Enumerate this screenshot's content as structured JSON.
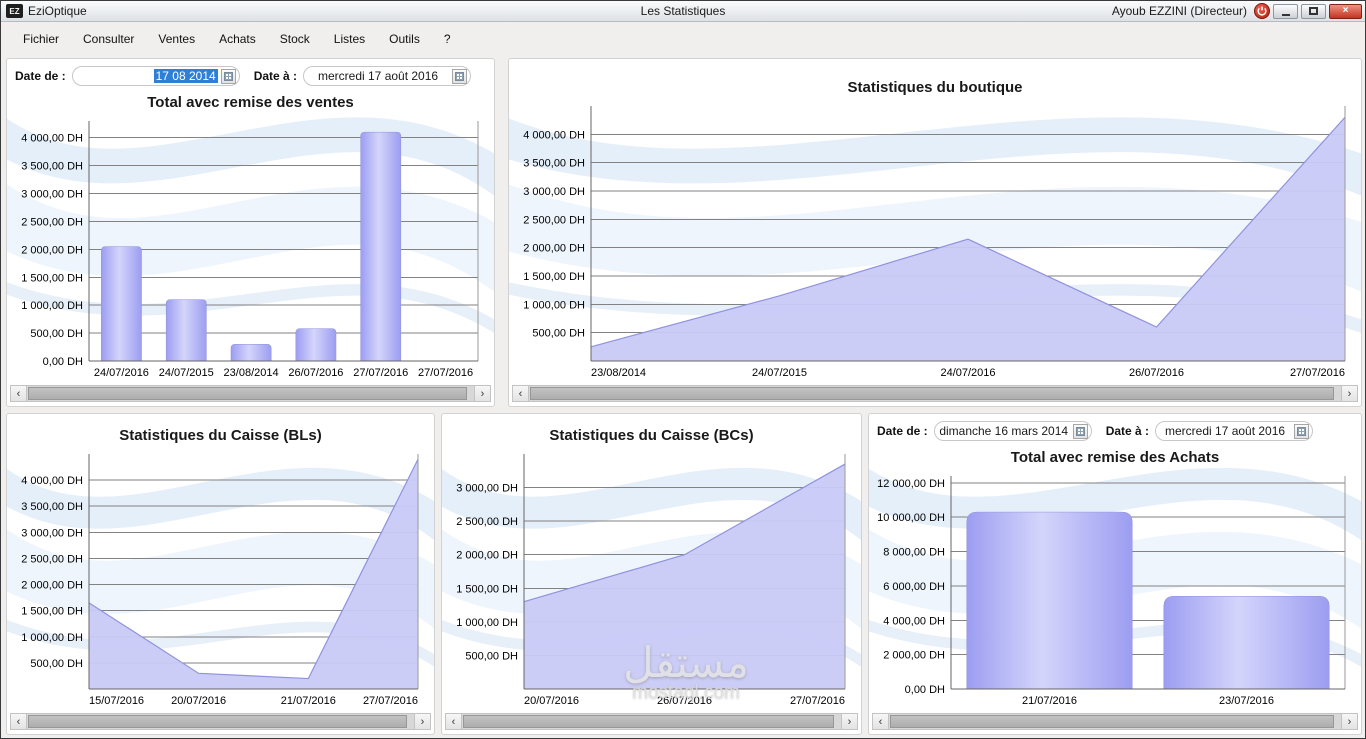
{
  "window": {
    "logo_text": "EZ",
    "app_name": "EziOptique",
    "title": "Les Statistiques",
    "user": "Ayoub EZZINI (Directeur)"
  },
  "icons": {
    "close": "×",
    "scroll_left": "‹",
    "scroll_right": "›"
  },
  "menu": {
    "items": [
      "Fichier",
      "Consulter",
      "Ventes",
      "Achats",
      "Stock",
      "Listes",
      "Outils",
      "?"
    ]
  },
  "filters": {
    "ventes": {
      "date_de_label": "Date de :",
      "date_de_value": "17 08 2014",
      "date_a_label": "Date à :",
      "date_a_value": "mercredi 17 août 2016"
    },
    "achats": {
      "date_de_label": "Date de :",
      "date_de_value": "dimanche 16 mars 2014",
      "date_a_label": "Date à :",
      "date_a_value": "mercredi 17 août 2016"
    }
  },
  "watermark": {
    "arabic": "مستقل",
    "latin": "mostaql.com"
  },
  "chart_data": [
    {
      "id": "ventes",
      "type": "bar",
      "title": "Total avec remise des ventes",
      "categories": [
        "24/07/2016",
        "24/07/2015",
        "23/08/2014",
        "26/07/2016",
        "27/07/2016",
        "27/07/2016"
      ],
      "values": [
        2050,
        1100,
        300,
        580,
        4100,
        0
      ],
      "ytick_values": [
        0,
        500,
        1000,
        1500,
        2000,
        2500,
        3000,
        3500,
        4000
      ],
      "ytick_labels": [
        "0,00 DH",
        "500,00 DH",
        "1 000,00 DH",
        "1 500,00 DH",
        "2 000,00 DH",
        "2 500,00 DH",
        "3 000,00 DH",
        "3 500,00 DH",
        "4 000,00 DH"
      ],
      "ymax": 4300,
      "xlabel": "",
      "ylabel": "",
      "grid": true,
      "legend": "none",
      "bar_width_ratio": 0.62,
      "bar_color": "#b4b5f3"
    },
    {
      "id": "boutique",
      "type": "area",
      "title": "Statistiques du boutique",
      "categories": [
        "23/08/2014",
        "24/07/2015",
        "24/07/2016",
        "26/07/2016",
        "27/07/2016"
      ],
      "values": [
        250,
        1150,
        2150,
        600,
        4300
      ],
      "ytick_values": [
        500,
        1000,
        1500,
        2000,
        2500,
        3000,
        3500,
        4000
      ],
      "ytick_labels": [
        "500,00 DH",
        "1 000,00 DH",
        "1 500,00 DH",
        "2 000,00 DH",
        "2 500,00 DH",
        "3 000,00 DH",
        "3 500,00 DH",
        "4 000,00 DH"
      ],
      "ymax": 4500,
      "xlabel": "",
      "ylabel": "",
      "grid": true,
      "legend": "none",
      "area_color": "#c9caf6"
    },
    {
      "id": "caisse_bls",
      "type": "area",
      "title": "Statistiques du Caisse (BLs)",
      "categories": [
        "15/07/2016",
        "20/07/2016",
        "21/07/2016",
        "27/07/2016"
      ],
      "values": [
        1650,
        300,
        200,
        4400
      ],
      "ytick_values": [
        500,
        1000,
        1500,
        2000,
        2500,
        3000,
        3500,
        4000
      ],
      "ytick_labels": [
        "500,00 DH",
        "1 000,00 DH",
        "1 500,00 DH",
        "2 000,00 DH",
        "2 500,00 DH",
        "3 000,00 DH",
        "3 500,00 DH",
        "4 000,00 DH"
      ],
      "ymax": 4500,
      "xlabel": "",
      "ylabel": "",
      "grid": true,
      "legend": "none",
      "area_color": "#c9caf6"
    },
    {
      "id": "caisse_bcs",
      "type": "area",
      "title": "Statistiques du Caisse (BCs)",
      "categories": [
        "20/07/2016",
        "26/07/2016",
        "27/07/2016"
      ],
      "values": [
        1300,
        2000,
        3350
      ],
      "ytick_values": [
        500,
        1000,
        1500,
        2000,
        2500,
        3000
      ],
      "ytick_labels": [
        "500,00 DH",
        "1 000,00 DH",
        "1 500,00 DH",
        "2 000,00 DH",
        "2 500,00 DH",
        "3 000,00 DH"
      ],
      "ymax": 3500,
      "xlabel": "",
      "ylabel": "",
      "grid": true,
      "legend": "none",
      "area_color": "#c9caf6"
    },
    {
      "id": "achats",
      "type": "bar",
      "title": "Total avec remise des Achats",
      "categories": [
        "21/07/2016",
        "23/07/2016"
      ],
      "values": [
        10300,
        5400
      ],
      "ytick_values": [
        0,
        2000,
        4000,
        6000,
        8000,
        10000,
        12000
      ],
      "ytick_labels": [
        "0,00 DH",
        "2 000,00 DH",
        "4 000,00 DH",
        "6 000,00 DH",
        "8 000,00 DH",
        "10 000,00 DH",
        "12 000,00 DH"
      ],
      "ymax": 12400,
      "xlabel": "",
      "ylabel": "",
      "grid": true,
      "legend": "none",
      "bar_width_ratio": 0.84,
      "bar_color": "#b4b5f3"
    }
  ]
}
